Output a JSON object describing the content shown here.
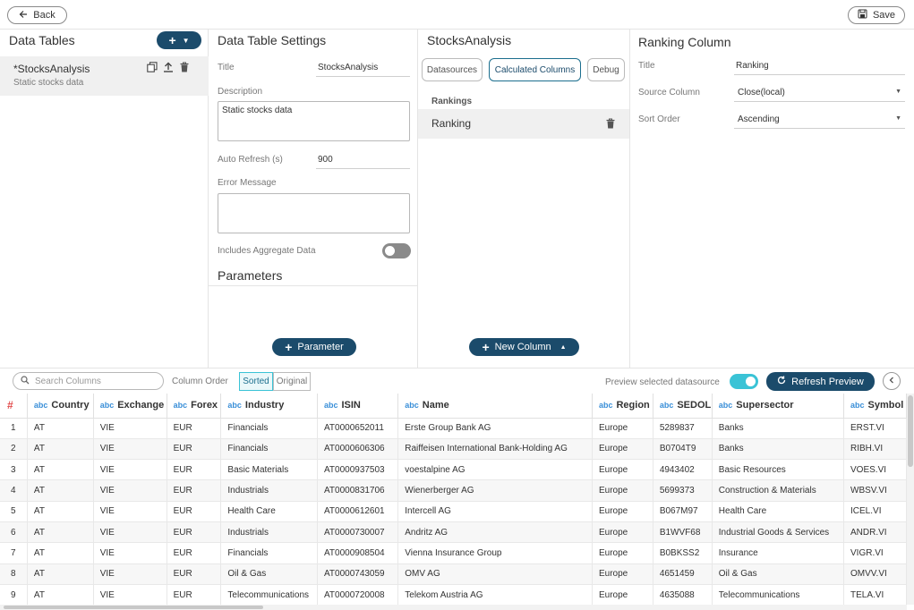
{
  "topbar": {
    "back_label": "Back",
    "save_label": "Save"
  },
  "data_tables": {
    "title": "Data Tables",
    "add_label": "+",
    "items": [
      {
        "name": "*StocksAnalysis",
        "description": "Static stocks data"
      }
    ]
  },
  "settings": {
    "title": "Data Table Settings",
    "title_label": "Title",
    "title_value": "StocksAnalysis",
    "description_label": "Description",
    "description_value": "Static stocks data",
    "auto_refresh_label": "Auto Refresh (s)",
    "auto_refresh_value": "900",
    "error_label": "Error Message",
    "error_value": "",
    "aggregate_label": "Includes Aggregate Data",
    "aggregate_on": false,
    "parameters_title": "Parameters",
    "parameter_button": "Parameter"
  },
  "datasource_panel": {
    "title": "StocksAnalysis",
    "tabs": [
      "Datasources",
      "Calculated Columns",
      "Debug"
    ],
    "active_tab": "Calculated Columns",
    "group_label": "Rankings",
    "items": [
      "Ranking"
    ],
    "new_column_button": "New Column"
  },
  "ranking_column": {
    "title": "Ranking Column",
    "title_label": "Title",
    "title_value": "Ranking",
    "source_label": "Source Column",
    "source_value": "Close(local)",
    "sort_label": "Sort Order",
    "sort_value": "Ascending"
  },
  "preview_toolbar": {
    "search_placeholder": "Search Columns",
    "column_order_label": "Column Order",
    "order_options": [
      "Sorted",
      "Original"
    ],
    "active_order": "Sorted",
    "preview_label": "Preview selected datasource",
    "preview_on": true,
    "refresh_button": "Refresh Preview"
  },
  "grid": {
    "type_prefix": "abc",
    "row_header": "#",
    "columns": [
      "Country",
      "Exchange",
      "Forex",
      "Industry",
      "ISIN",
      "Name",
      "Region",
      "SEDOL",
      "Supersector",
      "Symbol"
    ],
    "rows": [
      [
        "1",
        "AT",
        "VIE",
        "EUR",
        "Financials",
        "AT0000652011",
        "Erste Group Bank AG",
        "Europe",
        "5289837",
        "Banks",
        "ERST.VI"
      ],
      [
        "2",
        "AT",
        "VIE",
        "EUR",
        "Financials",
        "AT0000606306",
        "Raiffeisen International Bank-Holding AG",
        "Europe",
        "B0704T9",
        "Banks",
        "RIBH.VI"
      ],
      [
        "3",
        "AT",
        "VIE",
        "EUR",
        "Basic Materials",
        "AT0000937503",
        "voestalpine AG",
        "Europe",
        "4943402",
        "Basic Resources",
        "VOES.VI"
      ],
      [
        "4",
        "AT",
        "VIE",
        "EUR",
        "Industrials",
        "AT0000831706",
        "Wienerberger AG",
        "Europe",
        "5699373",
        "Construction & Materials",
        "WBSV.VI"
      ],
      [
        "5",
        "AT",
        "VIE",
        "EUR",
        "Health Care",
        "AT0000612601",
        "Intercell AG",
        "Europe",
        "B067M97",
        "Health Care",
        "ICEL.VI"
      ],
      [
        "6",
        "AT",
        "VIE",
        "EUR",
        "Industrials",
        "AT0000730007",
        "Andritz AG",
        "Europe",
        "B1WVF68",
        "Industrial Goods & Services",
        "ANDR.VI"
      ],
      [
        "7",
        "AT",
        "VIE",
        "EUR",
        "Financials",
        "AT0000908504",
        "Vienna Insurance Group",
        "Europe",
        "B0BKSS2",
        "Insurance",
        "VIGR.VI"
      ],
      [
        "8",
        "AT",
        "VIE",
        "EUR",
        "Oil & Gas",
        "AT0000743059",
        "OMV AG",
        "Europe",
        "4651459",
        "Oil & Gas",
        "OMVV.VI"
      ],
      [
        "9",
        "AT",
        "VIE",
        "EUR",
        "Telecommunications",
        "AT0000720008",
        "Telekom Austria AG",
        "Europe",
        "4635088",
        "Telecommunications",
        "TELA.VI"
      ]
    ]
  },
  "colors": {
    "primary": "#1b4b6b",
    "accent": "#3ac3d6",
    "type_tag": "#3a8fd8",
    "row_hash": "#e24d4d"
  }
}
